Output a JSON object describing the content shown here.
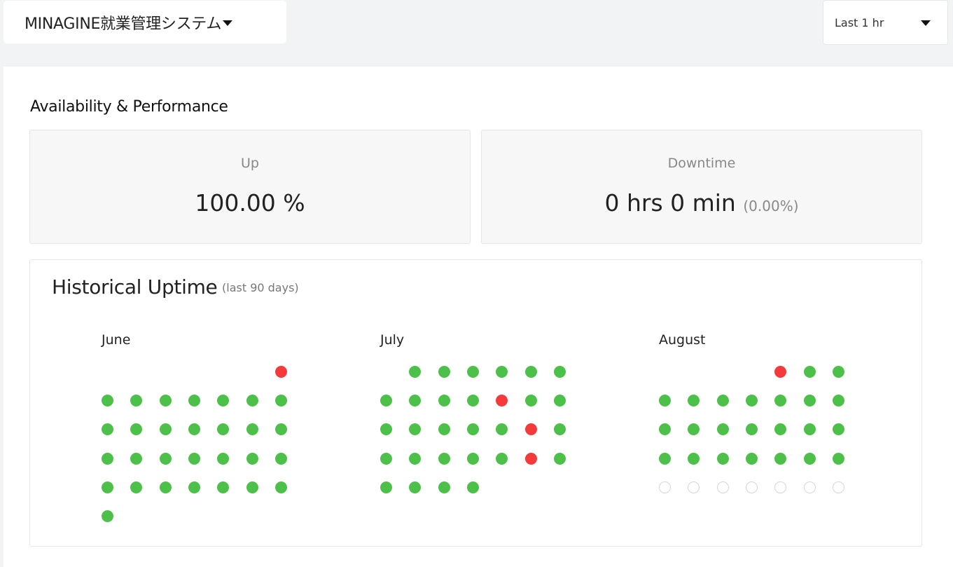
{
  "header": {
    "site_name": "MINAGINE就業管理システム",
    "range_label": "Last 1 hr"
  },
  "availability": {
    "title": "Availability & Performance",
    "up_label": "Up",
    "up_value": "100.00 %",
    "downtime_label": "Downtime",
    "downtime_value": "0 hrs 0 min",
    "downtime_pct": "(0.00%)"
  },
  "history": {
    "title": "Historical Uptime",
    "subtitle": "(last 90 days)",
    "months": [
      {
        "name": "June",
        "first_weekday": 6,
        "days": [
          "down",
          "up",
          "up",
          "up",
          "up",
          "up",
          "up",
          "up",
          "up",
          "up",
          "up",
          "up",
          "up",
          "up",
          "up",
          "up",
          "up",
          "up",
          "up",
          "up",
          "up",
          "up",
          "up",
          "up",
          "up",
          "up",
          "up",
          "up",
          "up",
          "up"
        ]
      },
      {
        "name": "July",
        "first_weekday": 1,
        "days": [
          "up",
          "up",
          "up",
          "up",
          "up",
          "up",
          "up",
          "up",
          "up",
          "up",
          "down",
          "up",
          "up",
          "up",
          "up",
          "up",
          "up",
          "up",
          "down",
          "up",
          "up",
          "up",
          "up",
          "up",
          "up",
          "down",
          "up",
          "up",
          "up",
          "up",
          "up"
        ]
      },
      {
        "name": "August",
        "first_weekday": 4,
        "days": [
          "down",
          "up",
          "up",
          "up",
          "up",
          "up",
          "up",
          "up",
          "up",
          "up",
          "up",
          "up",
          "up",
          "up",
          "up",
          "up",
          "up",
          "up",
          "up",
          "up",
          "up",
          "up",
          "up",
          "up",
          "none",
          "none",
          "none",
          "none",
          "none",
          "none",
          "none"
        ]
      }
    ]
  },
  "colors": {
    "up": "#4cc048",
    "down": "#f43a3a",
    "none": "#d6d6d6"
  }
}
